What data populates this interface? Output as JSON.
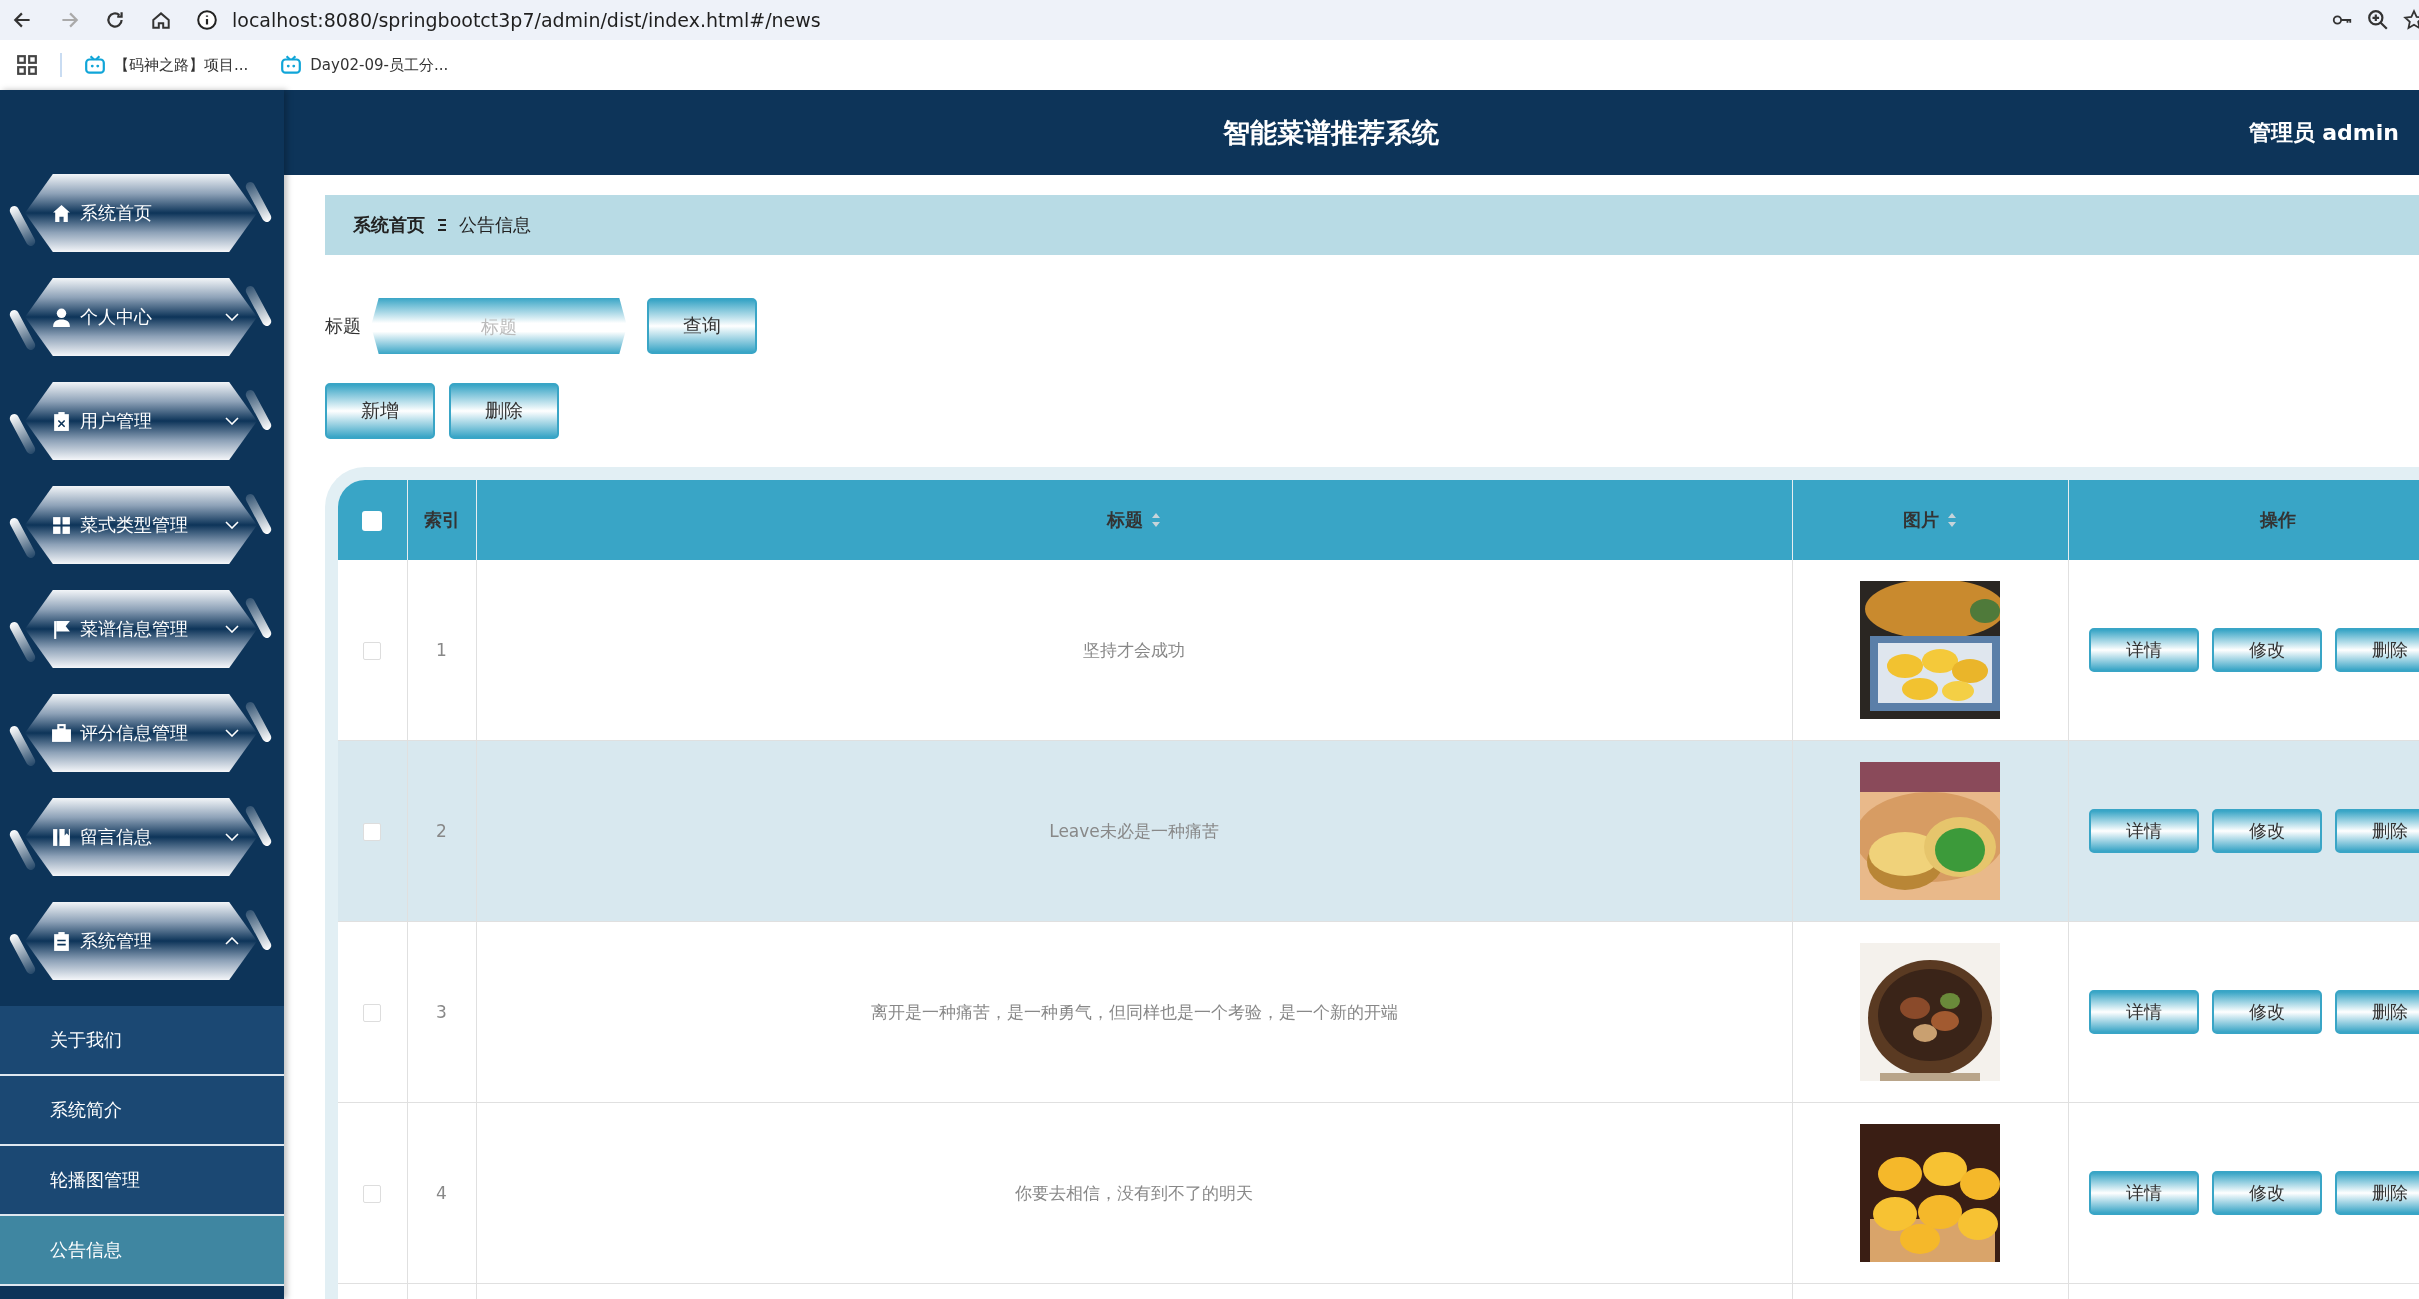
{
  "browser": {
    "url": "localhost:8080/springbootct3p7/admin/dist/index.html#/news",
    "bookmarks": [
      "【码神之路】项目...",
      "Day02-09-员工分..."
    ]
  },
  "header": {
    "title": "智能菜谱推荐系统",
    "user": "管理员 admin"
  },
  "sidebar": {
    "items": [
      {
        "label": "系统首页",
        "kind": "link"
      },
      {
        "label": "个人中心",
        "kind": "menu",
        "expanded": false
      },
      {
        "label": "用户管理",
        "kind": "menu",
        "expanded": false
      },
      {
        "label": "菜式类型管理",
        "kind": "menu",
        "expanded": false
      },
      {
        "label": "菜谱信息管理",
        "kind": "menu",
        "expanded": false
      },
      {
        "label": "评分信息管理",
        "kind": "menu",
        "expanded": false
      },
      {
        "label": "留言信息",
        "kind": "menu",
        "expanded": false
      },
      {
        "label": "系统管理",
        "kind": "menu",
        "expanded": true,
        "children": [
          {
            "label": "关于我们",
            "selected": false
          },
          {
            "label": "系统简介",
            "selected": false
          },
          {
            "label": "轮播图管理",
            "selected": false
          },
          {
            "label": "公告信息",
            "selected": true
          }
        ]
      }
    ]
  },
  "breadcrumb": [
    "系统首页",
    "公告信息"
  ],
  "search": {
    "label": "标题",
    "placeholder": "标题",
    "button": "查询"
  },
  "actions": [
    "新增",
    "删除"
  ],
  "table": {
    "all_checked": false,
    "columns": [
      {
        "label": "索引",
        "sortable": false
      },
      {
        "label": "标题",
        "sortable": true
      },
      {
        "label": "图片",
        "sortable": true
      },
      {
        "label": "操作",
        "sortable": false
      }
    ],
    "rows": [
      {
        "checked": false,
        "hovered": false,
        "index": "1",
        "title": "坚持才会成功",
        "image": {
          "kind": "picture"
        },
        "actions": [
          "详情",
          "修改",
          "删除"
        ]
      },
      {
        "checked": false,
        "hovered": true,
        "index": "2",
        "title": "Leave未必是一种痛苦",
        "image": {
          "kind": "picture"
        },
        "actions": [
          "详情",
          "修改",
          "删除"
        ]
      },
      {
        "checked": false,
        "hovered": false,
        "index": "3",
        "title": "离开是一种痛苦，是一种勇气，但同样也是一个考验，是一个新的开端",
        "image": {
          "kind": "picture"
        },
        "actions": [
          "详情",
          "修改",
          "删除"
        ]
      },
      {
        "checked": false,
        "hovered": false,
        "index": "4",
        "title": "你要去相信，没有到不了的明天",
        "image": {
          "kind": "picture"
        },
        "actions": [
          "详情",
          "修改",
          "删除"
        ]
      }
    ]
  }
}
